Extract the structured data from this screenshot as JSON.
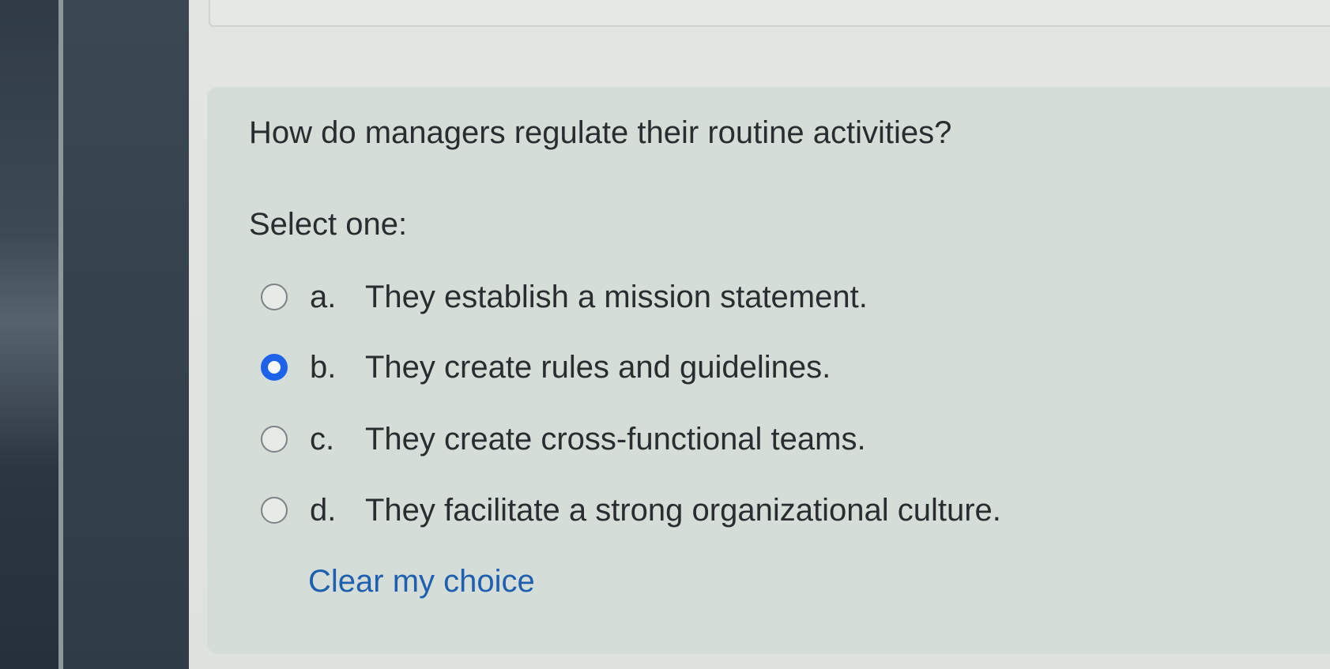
{
  "question": {
    "text": "How do managers regulate their routine activities?",
    "prompt": "Select one:"
  },
  "options": [
    {
      "letter": "a.",
      "text": "They establish a mission statement.",
      "selected": false
    },
    {
      "letter": "b.",
      "text": "They create rules and guidelines.",
      "selected": true
    },
    {
      "letter": "c.",
      "text": "They create cross-functional teams.",
      "selected": false
    },
    {
      "letter": "d.",
      "text": "They facilitate a strong organizational culture.",
      "selected": false
    }
  ],
  "clear_link": "Clear my choice",
  "colors": {
    "accent": "#1d62e8",
    "link": "#1f5fb0",
    "card_background": "#d4ddd8",
    "sidebar": "#34414c"
  }
}
